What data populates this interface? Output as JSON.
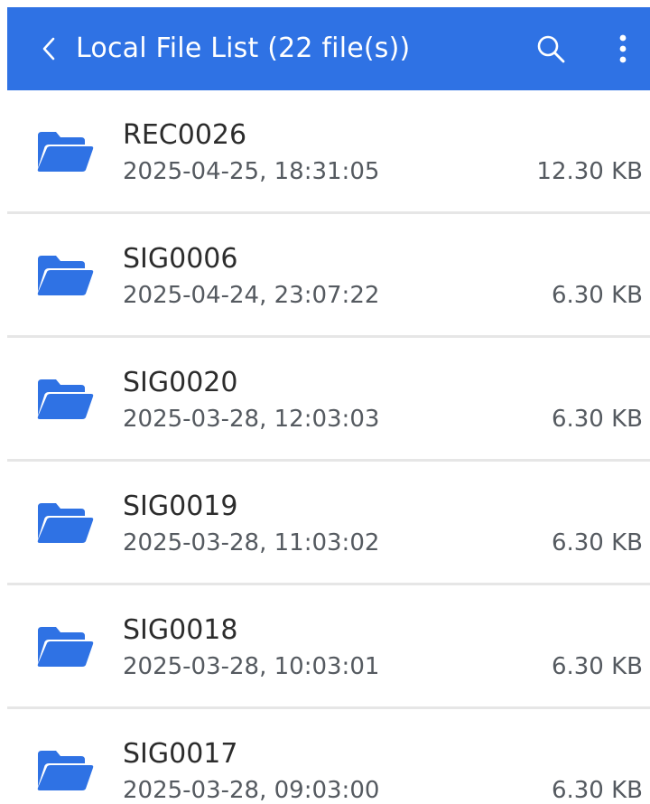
{
  "header": {
    "title": "Local File List (22 file(s))",
    "back_icon": "chevron-left-icon",
    "search_icon": "search-icon",
    "more_icon": "more-vert-icon"
  },
  "colors": {
    "accent": "#2f72e4",
    "folder": "#2f72e4",
    "divider": "#e6e6e6",
    "text_primary": "#2c2c2c",
    "text_secondary": "#555a60"
  },
  "files": [
    {
      "name": "REC0026",
      "datetime": "2025-04-25, 18:31:05",
      "size": "12.30 KB",
      "icon": "folder-icon"
    },
    {
      "name": "SIG0006",
      "datetime": "2025-04-24, 23:07:22",
      "size": "6.30 KB",
      "icon": "folder-icon"
    },
    {
      "name": "SIG0020",
      "datetime": "2025-03-28, 12:03:03",
      "size": "6.30 KB",
      "icon": "folder-icon"
    },
    {
      "name": "SIG0019",
      "datetime": "2025-03-28, 11:03:02",
      "size": "6.30 KB",
      "icon": "folder-icon"
    },
    {
      "name": "SIG0018",
      "datetime": "2025-03-28, 10:03:01",
      "size": "6.30 KB",
      "icon": "folder-icon"
    },
    {
      "name": "SIG0017",
      "datetime": "2025-03-28, 09:03:00",
      "size": "6.30 KB",
      "icon": "folder-icon"
    }
  ]
}
